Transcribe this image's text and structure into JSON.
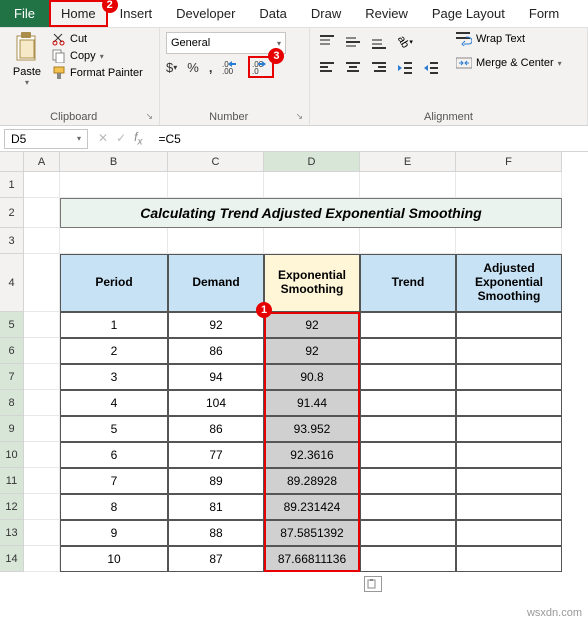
{
  "tabs": {
    "file": "File",
    "home": "Home",
    "insert": "Insert",
    "developer": "Developer",
    "data": "Data",
    "draw": "Draw",
    "review": "Review",
    "pagelayout": "Page Layout",
    "formulas": "Form"
  },
  "clipboard": {
    "paste": "Paste",
    "cut": "Cut",
    "copy": "Copy",
    "format_painter": "Format Painter",
    "group": "Clipboard"
  },
  "number": {
    "format": "General",
    "group": "Number",
    "dollar": "$",
    "percent": "%",
    "comma": ","
  },
  "alignment": {
    "group": "Alignment",
    "wrap": "Wrap Text",
    "merge": "Merge & Center"
  },
  "namebox": "D5",
  "formula": "=C5",
  "cols": [
    "A",
    "B",
    "C",
    "D",
    "E",
    "F"
  ],
  "sheet": {
    "title": "Calculating Trend Adjusted Exponential Smoothing",
    "headers": {
      "period": "Period",
      "demand": "Demand",
      "expsm": "Exponential Smoothing",
      "trend": "Trend",
      "adj": "Adjusted Exponential Smoothing"
    },
    "rows": [
      {
        "n": "5",
        "period": "1",
        "demand": "92",
        "exp": "92"
      },
      {
        "n": "6",
        "period": "2",
        "demand": "86",
        "exp": "92"
      },
      {
        "n": "7",
        "period": "3",
        "demand": "94",
        "exp": "90.8"
      },
      {
        "n": "8",
        "period": "4",
        "demand": "104",
        "exp": "91.44"
      },
      {
        "n": "9",
        "period": "5",
        "demand": "86",
        "exp": "93.952"
      },
      {
        "n": "10",
        "period": "6",
        "demand": "77",
        "exp": "92.3616"
      },
      {
        "n": "11",
        "period": "7",
        "demand": "89",
        "exp": "89.28928"
      },
      {
        "n": "12",
        "period": "8",
        "demand": "81",
        "exp": "89.231424"
      },
      {
        "n": "13",
        "period": "9",
        "demand": "88",
        "exp": "87.5851392"
      },
      {
        "n": "14",
        "period": "10",
        "demand": "87",
        "exp": "87.66811136"
      }
    ]
  },
  "watermark": "wsxdn.com",
  "chart_data": {
    "type": "table",
    "title": "Calculating Trend Adjusted Exponential Smoothing",
    "columns": [
      "Period",
      "Demand",
      "Exponential Smoothing",
      "Trend",
      "Adjusted Exponential Smoothing"
    ],
    "data": [
      [
        1,
        92,
        92,
        null,
        null
      ],
      [
        2,
        86,
        92,
        null,
        null
      ],
      [
        3,
        94,
        90.8,
        null,
        null
      ],
      [
        4,
        104,
        91.44,
        null,
        null
      ],
      [
        5,
        86,
        93.952,
        null,
        null
      ],
      [
        6,
        77,
        92.3616,
        null,
        null
      ],
      [
        7,
        89,
        89.28928,
        null,
        null
      ],
      [
        8,
        81,
        89.231424,
        null,
        null
      ],
      [
        9,
        88,
        87.5851392,
        null,
        null
      ],
      [
        10,
        87,
        87.66811136,
        null,
        null
      ]
    ]
  }
}
